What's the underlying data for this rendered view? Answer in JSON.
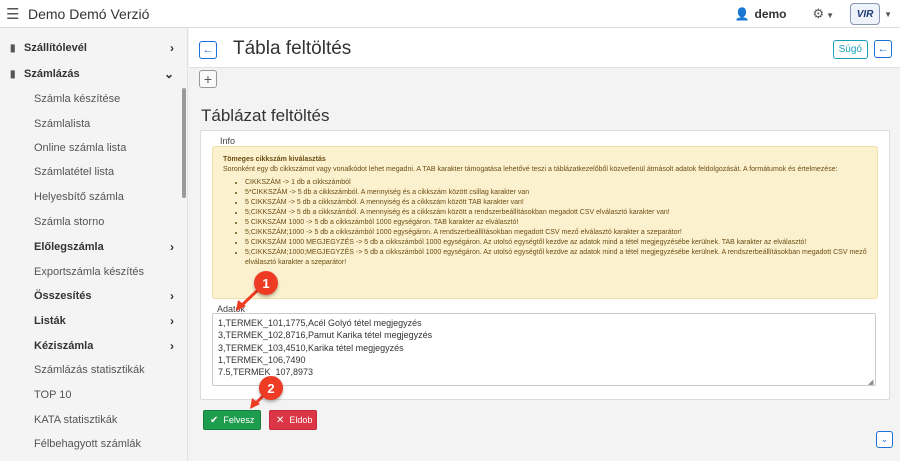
{
  "header": {
    "title": "Demo Demó Verzió",
    "user": "demo",
    "logo_text": "VIR"
  },
  "sidebar": {
    "items": [
      {
        "label": "Szállítólevél",
        "chevron": "›"
      },
      {
        "label": "Számlázás",
        "chevron": "⌄"
      },
      {
        "label": "Számla készítése"
      },
      {
        "label": "Számlalista"
      },
      {
        "label": "Online számla lista"
      },
      {
        "label": "Számlatétel lista"
      },
      {
        "label": "Helyesbítő számla"
      },
      {
        "label": "Számla storno"
      },
      {
        "label": "Előlegszámla",
        "chevron": "›"
      },
      {
        "label": "Exportszámla készítés"
      },
      {
        "label": "Összesítés",
        "chevron": "›"
      },
      {
        "label": "Listák",
        "chevron": "›"
      },
      {
        "label": "Kéziszámla",
        "chevron": "›"
      },
      {
        "label": "Számlázás statisztikák"
      },
      {
        "label": "TOP 10"
      },
      {
        "label": "KATA statisztikák"
      },
      {
        "label": "Félbehagyott számlák"
      }
    ]
  },
  "page": {
    "title": "Tábla feltöltés",
    "help_label": "Súgó",
    "plus_label": "+",
    "section_title": "Táblázat feltöltés"
  },
  "info": {
    "legend": "Info",
    "heading": "Tömeges cikkszám kiválasztás",
    "description": "Soronként egy db cikkszámot vagy vonalkódot lehet megadni. A TAB karakter támogatása lehetővé teszi a táblázatkezelőből közvetlenül átmásolt adatok feldolgozását. A formátumok és értelmezése:",
    "items": [
      "CIKKSZÁM -> 1 db a cikkszámból",
      "5*CIKKSZÁM -> 5 db a cikkszámból. A mennyiség és a cikkszám között csillag karakter van",
      "5 CIKKSZÁM -> 5 db a cikkszámból. A mennyiség és a cikkszám között TAB karakter van!",
      "5;CIKKSZÁM -> 5 db a cikkszámból. A mennyiség és a cikkszám között a rendszerbeállításokban megadott CSV elválasztó karakter van!",
      "5 CIKKSZÁM 1000 -> 5 db a cikkszámból 1000 egységáron. TAB karakter az elválasztó!",
      "5;CIKKSZÁM;1000 -> 5 db a cikkszámból 1000 egységáron. A rendszerbeállításokban megadott CSV mező elválasztó karakter a szeparátor!",
      "5 CIKKSZÁM 1000 MEGJEGYZÉS -> 5 db a cikkszámból 1000 egységáron. Az utolsó egységtől kezdve az adatok mind a tétel megjegyzésébe kerülnek. TAB karakter az elválasztó!",
      "5;CIKKSZÁM;1000;MEGJEGYZÉS -> 5 db a cikkszámból 1000 egységáron. Az utolsó egységtől kezdve az adatok mind a tétel megjegyzésébe kerülnek. A rendszerbeállításokban megadott CSV mező elválasztó karakter a szeparátor!"
    ]
  },
  "data_input": {
    "legend": "Adatok",
    "value": "1,TERMEK_101,1775,Acél Golyó tétel megjegyzés\n3,TERMEK_102,8716,Pamut Karika tétel megjegyzés\n3,TERMEK_103,4510,Karika tétel megjegyzés\n1,TERMEK_106,7490\n7.5,TERMEK_107,8973"
  },
  "buttons": {
    "save": "Felvesz",
    "cancel": "Eldob"
  },
  "callouts": {
    "first": "1",
    "second": "2"
  },
  "colors": {
    "accent": "#1e6fd9",
    "save": "#1f9d4e",
    "cancel": "#dc3545",
    "callout": "#ee3b24",
    "info_bg": "#fcf1cf"
  }
}
